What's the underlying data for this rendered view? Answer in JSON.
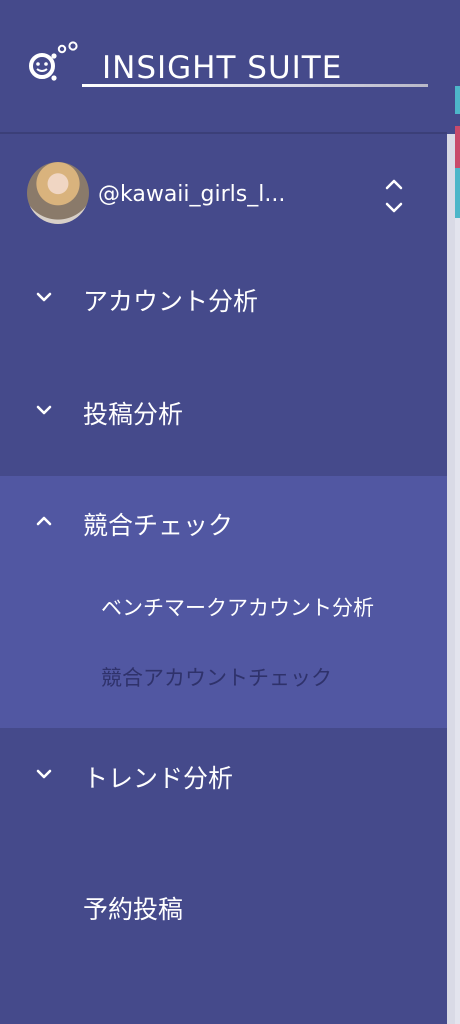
{
  "app": {
    "logo_text": "INSIGHT SUITE"
  },
  "account": {
    "handle": "@kawaii_girls_l..."
  },
  "menu": {
    "items": [
      {
        "label": "アカウント分析",
        "expanded": false
      },
      {
        "label": "投稿分析",
        "expanded": false
      },
      {
        "label": "競合チェック",
        "expanded": true,
        "children": [
          {
            "label": "ベンチマークアカウント分析"
          },
          {
            "label": "競合アカウントチェック"
          }
        ]
      },
      {
        "label": "トレンド分析",
        "expanded": false
      },
      {
        "label": "予約投稿"
      }
    ]
  },
  "colors": {
    "sidebar_bg": "#454a8b",
    "expanded_bg": "#5157a2",
    "dim_text": "#2f326b",
    "accent_teal": "#4db6c9",
    "accent_red": "#c94a6a"
  }
}
